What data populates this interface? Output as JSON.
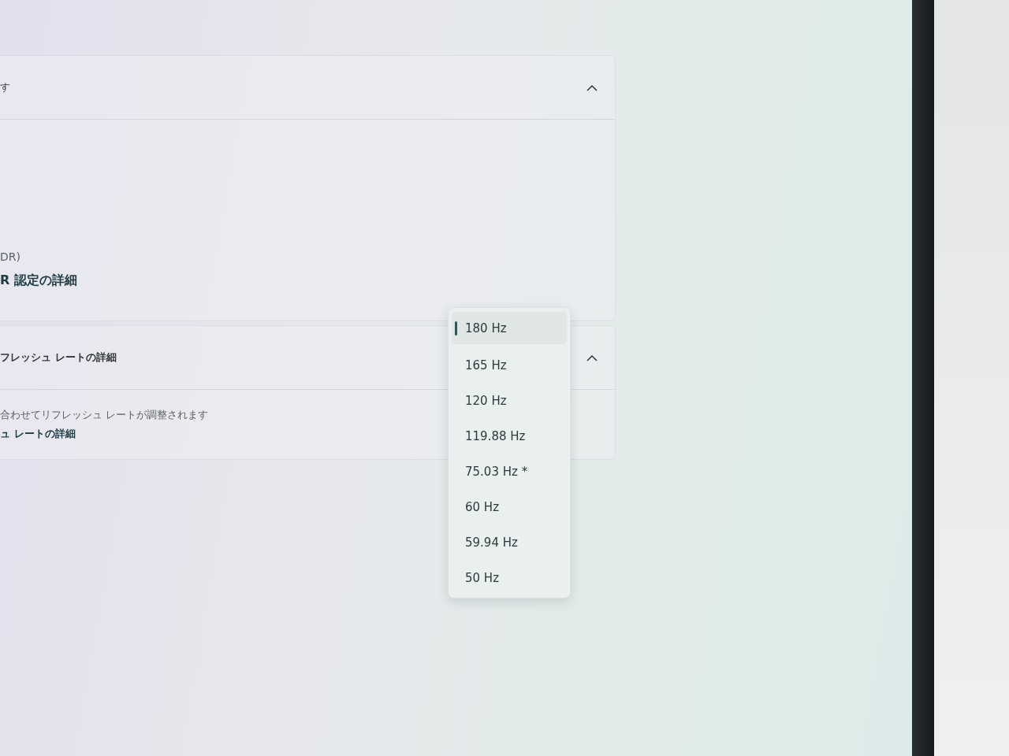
{
  "cards": [
    {
      "header": {
        "kind": "text",
        "text": "す",
        "expanded": true
      },
      "lines": [
        {
          "kind": "text",
          "text": "DR)"
        },
        {
          "kind": "link",
          "text": "R 認定の詳細"
        }
      ]
    },
    {
      "header": {
        "kind": "link",
        "text": "フレッシュ レートの詳細",
        "expanded": true
      },
      "lines": [
        {
          "kind": "text",
          "text": "合わせてリフレッシュ レートが調整されます"
        },
        {
          "kind": "link",
          "text": "ュ レートの詳細"
        }
      ]
    }
  ],
  "dropdown": {
    "items": [
      {
        "label": "180 Hz",
        "selected": true
      },
      {
        "label": "165 Hz",
        "selected": false
      },
      {
        "label": "120 Hz",
        "selected": false
      },
      {
        "label": "119.88 Hz",
        "selected": false
      },
      {
        "label": "75.03 Hz *",
        "selected": false
      },
      {
        "label": "60 Hz",
        "selected": false
      },
      {
        "label": "59.94 Hz",
        "selected": false
      },
      {
        "label": "50 Hz",
        "selected": false
      }
    ]
  }
}
